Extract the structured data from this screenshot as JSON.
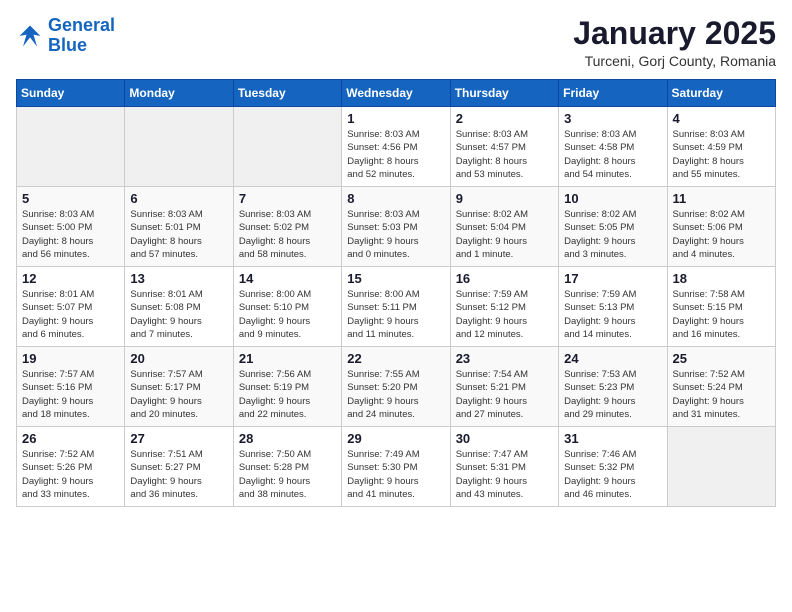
{
  "header": {
    "logo_line1": "General",
    "logo_line2": "Blue",
    "title": "January 2025",
    "subtitle": "Turceni, Gorj County, Romania"
  },
  "weekdays": [
    "Sunday",
    "Monday",
    "Tuesday",
    "Wednesday",
    "Thursday",
    "Friday",
    "Saturday"
  ],
  "weeks": [
    [
      {
        "day": "",
        "info": ""
      },
      {
        "day": "",
        "info": ""
      },
      {
        "day": "",
        "info": ""
      },
      {
        "day": "1",
        "info": "Sunrise: 8:03 AM\nSunset: 4:56 PM\nDaylight: 8 hours\nand 52 minutes."
      },
      {
        "day": "2",
        "info": "Sunrise: 8:03 AM\nSunset: 4:57 PM\nDaylight: 8 hours\nand 53 minutes."
      },
      {
        "day": "3",
        "info": "Sunrise: 8:03 AM\nSunset: 4:58 PM\nDaylight: 8 hours\nand 54 minutes."
      },
      {
        "day": "4",
        "info": "Sunrise: 8:03 AM\nSunset: 4:59 PM\nDaylight: 8 hours\nand 55 minutes."
      }
    ],
    [
      {
        "day": "5",
        "info": "Sunrise: 8:03 AM\nSunset: 5:00 PM\nDaylight: 8 hours\nand 56 minutes."
      },
      {
        "day": "6",
        "info": "Sunrise: 8:03 AM\nSunset: 5:01 PM\nDaylight: 8 hours\nand 57 minutes."
      },
      {
        "day": "7",
        "info": "Sunrise: 8:03 AM\nSunset: 5:02 PM\nDaylight: 8 hours\nand 58 minutes."
      },
      {
        "day": "8",
        "info": "Sunrise: 8:03 AM\nSunset: 5:03 PM\nDaylight: 9 hours\nand 0 minutes."
      },
      {
        "day": "9",
        "info": "Sunrise: 8:02 AM\nSunset: 5:04 PM\nDaylight: 9 hours\nand 1 minute."
      },
      {
        "day": "10",
        "info": "Sunrise: 8:02 AM\nSunset: 5:05 PM\nDaylight: 9 hours\nand 3 minutes."
      },
      {
        "day": "11",
        "info": "Sunrise: 8:02 AM\nSunset: 5:06 PM\nDaylight: 9 hours\nand 4 minutes."
      }
    ],
    [
      {
        "day": "12",
        "info": "Sunrise: 8:01 AM\nSunset: 5:07 PM\nDaylight: 9 hours\nand 6 minutes."
      },
      {
        "day": "13",
        "info": "Sunrise: 8:01 AM\nSunset: 5:08 PM\nDaylight: 9 hours\nand 7 minutes."
      },
      {
        "day": "14",
        "info": "Sunrise: 8:00 AM\nSunset: 5:10 PM\nDaylight: 9 hours\nand 9 minutes."
      },
      {
        "day": "15",
        "info": "Sunrise: 8:00 AM\nSunset: 5:11 PM\nDaylight: 9 hours\nand 11 minutes."
      },
      {
        "day": "16",
        "info": "Sunrise: 7:59 AM\nSunset: 5:12 PM\nDaylight: 9 hours\nand 12 minutes."
      },
      {
        "day": "17",
        "info": "Sunrise: 7:59 AM\nSunset: 5:13 PM\nDaylight: 9 hours\nand 14 minutes."
      },
      {
        "day": "18",
        "info": "Sunrise: 7:58 AM\nSunset: 5:15 PM\nDaylight: 9 hours\nand 16 minutes."
      }
    ],
    [
      {
        "day": "19",
        "info": "Sunrise: 7:57 AM\nSunset: 5:16 PM\nDaylight: 9 hours\nand 18 minutes."
      },
      {
        "day": "20",
        "info": "Sunrise: 7:57 AM\nSunset: 5:17 PM\nDaylight: 9 hours\nand 20 minutes."
      },
      {
        "day": "21",
        "info": "Sunrise: 7:56 AM\nSunset: 5:19 PM\nDaylight: 9 hours\nand 22 minutes."
      },
      {
        "day": "22",
        "info": "Sunrise: 7:55 AM\nSunset: 5:20 PM\nDaylight: 9 hours\nand 24 minutes."
      },
      {
        "day": "23",
        "info": "Sunrise: 7:54 AM\nSunset: 5:21 PM\nDaylight: 9 hours\nand 27 minutes."
      },
      {
        "day": "24",
        "info": "Sunrise: 7:53 AM\nSunset: 5:23 PM\nDaylight: 9 hours\nand 29 minutes."
      },
      {
        "day": "25",
        "info": "Sunrise: 7:52 AM\nSunset: 5:24 PM\nDaylight: 9 hours\nand 31 minutes."
      }
    ],
    [
      {
        "day": "26",
        "info": "Sunrise: 7:52 AM\nSunset: 5:26 PM\nDaylight: 9 hours\nand 33 minutes."
      },
      {
        "day": "27",
        "info": "Sunrise: 7:51 AM\nSunset: 5:27 PM\nDaylight: 9 hours\nand 36 minutes."
      },
      {
        "day": "28",
        "info": "Sunrise: 7:50 AM\nSunset: 5:28 PM\nDaylight: 9 hours\nand 38 minutes."
      },
      {
        "day": "29",
        "info": "Sunrise: 7:49 AM\nSunset: 5:30 PM\nDaylight: 9 hours\nand 41 minutes."
      },
      {
        "day": "30",
        "info": "Sunrise: 7:47 AM\nSunset: 5:31 PM\nDaylight: 9 hours\nand 43 minutes."
      },
      {
        "day": "31",
        "info": "Sunrise: 7:46 AM\nSunset: 5:32 PM\nDaylight: 9 hours\nand 46 minutes."
      },
      {
        "day": "",
        "info": ""
      }
    ]
  ]
}
